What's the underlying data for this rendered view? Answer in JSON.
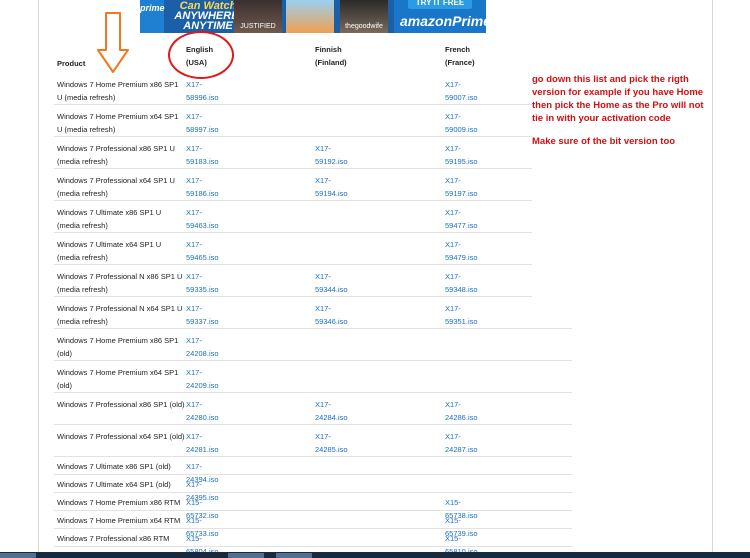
{
  "banner": {
    "logo_text": "prime",
    "slogan_line1": "Can Watch",
    "slogan_line2": "ANYWHERE,",
    "slogan_line3": "ANYTIME",
    "poster1_text": "JUSTIFIED",
    "poster3_text": "thegoodwife",
    "cta_try": "TRY IT FREE",
    "cta_brand": "amazonPrime"
  },
  "table": {
    "headers": {
      "product": "Product",
      "english": "English",
      "english_region": "(USA)",
      "finnish": "Finnish",
      "finnish_region": "(Finland)",
      "french": "French",
      "french_region": "(France)"
    },
    "rows": [
      {
        "product": "Windows 7 Home Premium x86 SP1 U (media refresh)",
        "english": "X17-58996.iso",
        "finnish": "",
        "french": "X17-59007.iso"
      },
      {
        "product": "Windows 7 Home Premium x64 SP1 U (media refresh)",
        "english": "X17-58997.iso",
        "finnish": "",
        "french": "X17-59009.iso"
      },
      {
        "product": "Windows 7 Professional x86 SP1 U (media refresh)",
        "english": "X17-59183.iso",
        "finnish": "X17-59192.iso",
        "french": "X17-59195.iso"
      },
      {
        "product": "Windows 7 Professional x64 SP1 U (media refresh)",
        "english": "X17-59186.iso",
        "finnish": "X17-59194.iso",
        "french": "X17-59197.iso"
      },
      {
        "product": "Windows 7 Ultimate x86 SP1 U (media refresh)",
        "english": "X17-59463.iso",
        "finnish": "",
        "french": "X17-59477.iso"
      },
      {
        "product": "Windows 7 Ultimate x64 SP1 U (media refresh)",
        "english": "X17-59465.iso",
        "finnish": "",
        "french": "X17-59479.iso"
      },
      {
        "product": "Windows 7 Professional N x86 SP1 U (media refresh)",
        "english": "X17-59335.iso",
        "finnish": "X17-59344.iso",
        "french": "X17-59348.iso"
      },
      {
        "product": "Windows 7 Professional N x64 SP1 U (media refresh)",
        "english": "X17-59337.iso",
        "finnish": "X17-59346.iso",
        "french": "X17-59351.iso"
      },
      {
        "product": "Windows 7 Home Premium x86 SP1 (old)",
        "english": "X17-24208.iso",
        "finnish": "",
        "french": ""
      },
      {
        "product": "Windows 7 Home Premium x64 SP1 (old)",
        "english": "X17-24209.iso",
        "finnish": "",
        "french": ""
      },
      {
        "product": "Windows 7 Professional x86 SP1 (old)",
        "english": "X17-24280.iso",
        "finnish": "X17-24284.iso",
        "french": "X17-24286.iso"
      },
      {
        "product": "Windows 7 Professional x64 SP1 (old)",
        "english": "X17-24281.iso",
        "finnish": "X17-24285.iso",
        "french": "X17-24287.iso"
      },
      {
        "product": "Windows 7 Ultimate x86 SP1 (old)",
        "english": "X17-24394.iso",
        "finnish": "",
        "french": ""
      },
      {
        "product": "Windows 7 Ultimate x64 SP1 (old)",
        "english": "X17-24395.iso",
        "finnish": "",
        "french": ""
      },
      {
        "product": "Windows 7 Home Premium x86 RTM",
        "english": "X15-65732.iso",
        "finnish": "",
        "french": "X15-65738.iso"
      },
      {
        "product": "Windows 7 Home Premium x64 RTM",
        "english": "X15-65733.iso",
        "finnish": "",
        "french": "X15-65739.iso"
      },
      {
        "product": "Windows 7 Professional x86 RTM",
        "english": "X15-65804.iso",
        "finnish": "",
        "french": "X15-65810.iso"
      }
    ]
  },
  "annotation": {
    "note1": "go down this list and pick the rigth version for example if you have Home then pick the Home as the Pro will not tie in with your activation code",
    "note2": "Make sure of the bit version too"
  },
  "colors": {
    "link": "#1a6fc4",
    "annotation": "#d01010",
    "arrow": "#f07820"
  }
}
